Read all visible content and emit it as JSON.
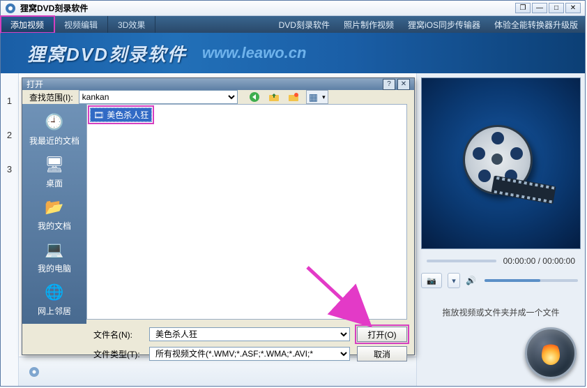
{
  "app": {
    "title": "狸窝DVD刻录软件"
  },
  "winbtns": {
    "restore": "❐",
    "min": "—",
    "max": "□",
    "close": "✕"
  },
  "menubar": {
    "tabs": [
      {
        "label": "添加视频"
      },
      {
        "label": "视频编辑"
      },
      {
        "label": "3D效果"
      }
    ],
    "links": [
      {
        "label": "DVD刻录软件"
      },
      {
        "label": "照片制作视频"
      },
      {
        "label": "狸窝iOS同步传输器"
      },
      {
        "label": "体验全能转换器升级版"
      }
    ]
  },
  "banner": {
    "title": "狸窝DVD刻录软件",
    "url": "www.leawo.cn"
  },
  "leftnums": [
    "1",
    "2",
    "3"
  ],
  "preview": {
    "time": "00:00:00 / 00:00:00"
  },
  "controls": {
    "camera": "📷",
    "camera_caret": "▾",
    "speaker": "🔊"
  },
  "hint": "拖放视频或文件夹并成一个文件",
  "dialog": {
    "title": "打开",
    "help": "?",
    "close": "✕",
    "range_label": "查找范围(I):",
    "range_value": "kankan",
    "range_icon": "📁",
    "nav": {
      "back": "←",
      "up": "↑",
      "newfolder": "📁",
      "views": "▦",
      "views_caret": "▾"
    },
    "places": [
      {
        "icon": "🕘",
        "label": "我最近的文档"
      },
      {
        "icon": "🖥",
        "label": "桌面"
      },
      {
        "icon": "📂",
        "label": "我的文档"
      },
      {
        "icon": "💻",
        "label": "我的电脑"
      },
      {
        "icon": "🌐",
        "label": "网上邻居"
      }
    ],
    "file": {
      "icon": "🎞",
      "name": "美色杀人狂"
    },
    "filename_label": "文件名(N):",
    "filename_value": "美色杀人狂",
    "filetype_label": "文件类型(T):",
    "filetype_value": "所有视频文件(*.WMV;*.ASF;*.WMA;*.AVI;*",
    "open_btn": "打开(O)",
    "cancel_btn": "取消"
  }
}
